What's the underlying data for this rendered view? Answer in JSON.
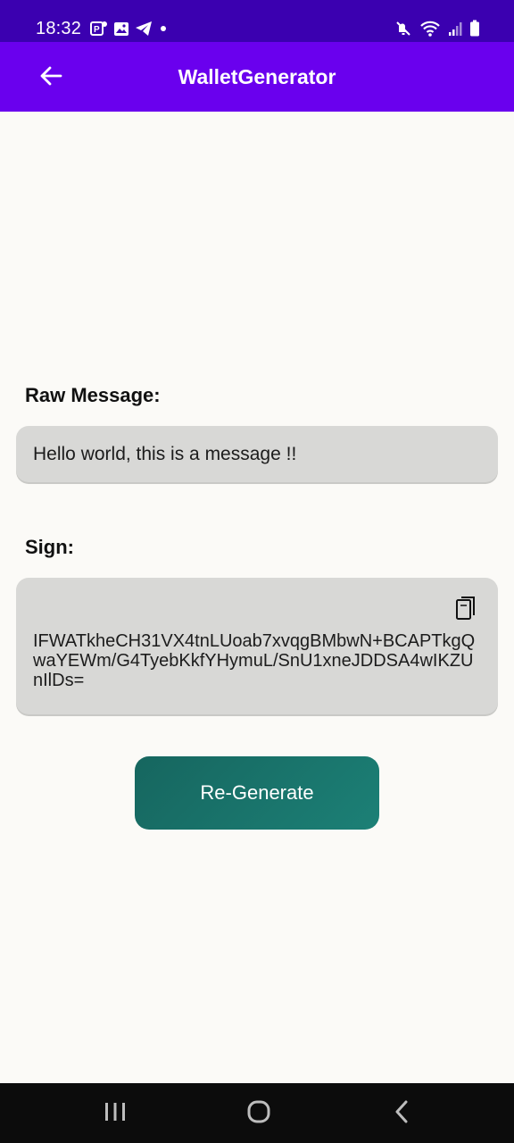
{
  "status_bar": {
    "time": "18:32",
    "left_icons": [
      "notification-p-icon",
      "image-icon",
      "telegram-icon",
      "dot-icon"
    ],
    "right_icons": [
      "mute-icon",
      "wifi-icon",
      "signal-icon",
      "battery-icon"
    ]
  },
  "app_bar": {
    "title": "WalletGenerator",
    "back_icon": "arrow-left-icon",
    "background": "#6a00ee"
  },
  "raw_message": {
    "label": "Raw Message:",
    "value": "Hello world, this is a message !!"
  },
  "sign": {
    "label": "Sign:",
    "value": "IFWATkheCH31VX4tnLUoab7xvqgBMbwN+BCAPTkgQwaYEWm/G4TyebKkfYHymuL/SnU1xneJDDSA4wIKZUnIlDs=",
    "copy_icon": "copy-icon"
  },
  "actions": {
    "regenerate_label": "Re-Generate",
    "button_color": "#1a7870"
  },
  "nav_bar": {
    "icons": [
      "recents-icon",
      "home-icon",
      "back-chevron-icon"
    ]
  }
}
